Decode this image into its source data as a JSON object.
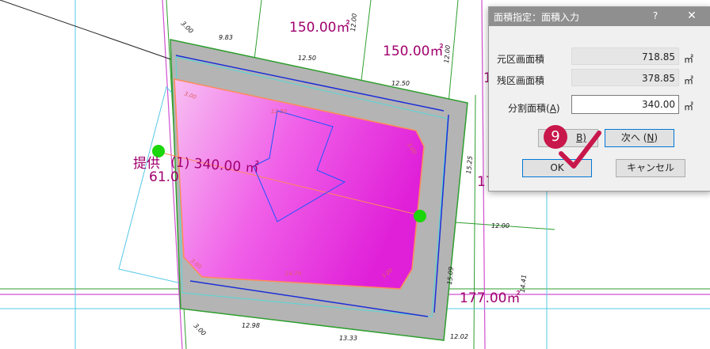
{
  "dialog": {
    "title": "面積指定：面積入力",
    "help": "?",
    "close": "✕",
    "original_area_label": "元区画面積",
    "original_area_value": "718.85",
    "remaining_area_label": "残区画面積",
    "remaining_area_value": "378.85",
    "split_area_label_prefix": "分割面積(",
    "split_area_label_key": "A",
    "split_area_label_suffix": ")",
    "split_area_value": "340.00",
    "unit": "㎡",
    "back_button": "B)",
    "next_button_prefix": "次へ (",
    "next_button_key": "N",
    "next_button_suffix": ")",
    "ok_button": "OK",
    "cancel_button": "キャンセル"
  },
  "annotation": {
    "step_number": "9"
  },
  "drawing": {
    "area_labels": [
      "150.00㎡",
      "150.00㎡",
      "177.00㎡",
      "(1) 340.00 ㎡"
    ],
    "partial_labels": [
      "提供",
      "61.0",
      "17",
      "1"
    ],
    "dimensions": [
      "3.00",
      "9.83",
      "12.50",
      "12.50",
      "12.00",
      "12.00",
      "15.25",
      "12.00",
      "15.09",
      "14.41",
      "12.98",
      "13.33",
      "12.02",
      "3.00",
      "3.00",
      "24.79",
      "3.00",
      "3.00",
      "3.00",
      "12.50"
    ]
  }
}
